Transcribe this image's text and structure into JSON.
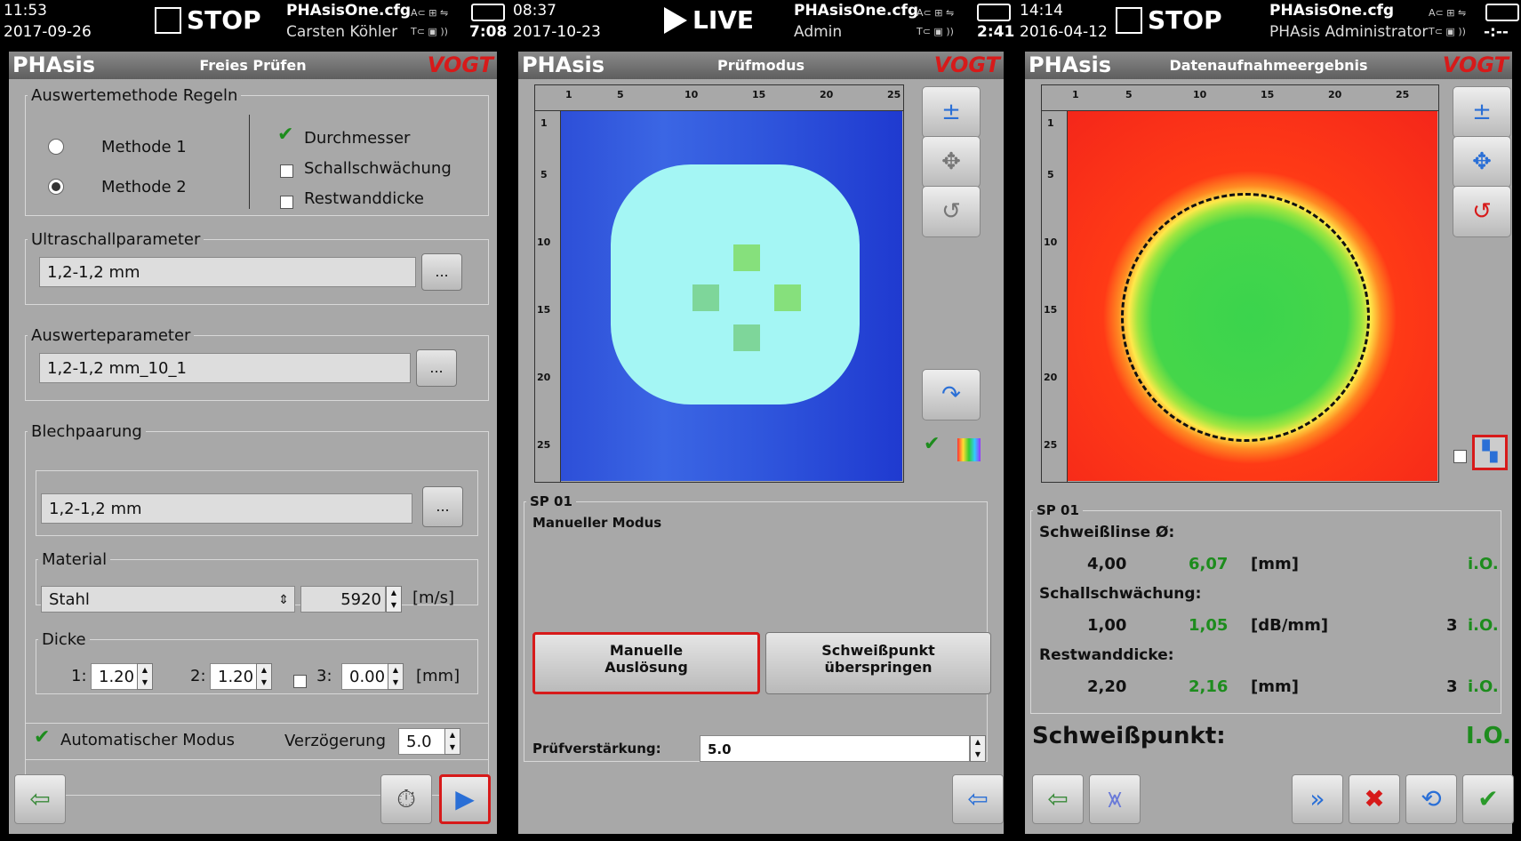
{
  "left": {
    "time": "11:53",
    "date": "2017-09-26",
    "mode": "STOP",
    "config": "PHAsisOne.cfg",
    "user": "Carsten Köhler",
    "clock": "7:08",
    "brand": "PHAsis",
    "title": "Freies Prüfen",
    "logo": "VOGT",
    "eval_method": {
      "legend": "Auswertemethode Regeln",
      "method1": "Methode 1",
      "method2": "Methode 2",
      "durchmesser": "Durchmesser",
      "schall": "Schallschwächung",
      "restwand": "Restwanddicke"
    },
    "ultrasound": {
      "legend": "Ultraschallparameter",
      "value": "1,2-1,2 mm",
      "more": "..."
    },
    "evalparam": {
      "legend": "Auswerteparameter",
      "value": "1,2-1,2 mm_10_1",
      "more": "..."
    },
    "sheet": {
      "legend": "Blechpaarung",
      "value": "1,2-1,2 mm",
      "more": "...",
      "material_legend": "Material",
      "material": "Stahl",
      "speed": "5920",
      "speed_unit": "[m/s]",
      "thickness_legend": "Dicke",
      "t1_label": "1:",
      "t1": "1.20",
      "t2_label": "2:",
      "t2": "1.20",
      "t3_label": "3:",
      "t3": "0.00",
      "t_unit": "[mm]"
    },
    "auto_mode": "Automatischer Modus",
    "delay_label": "Verzögerung",
    "delay": "5.0"
  },
  "middle": {
    "time": "08:37",
    "date": "2017-10-23",
    "mode": "LIVE",
    "config": "PHAsisOne.cfg",
    "user": "Admin",
    "clock": "2:41",
    "brand": "PHAsis",
    "title": "Prüfmodus",
    "logo": "VOGT",
    "sp": "SP 01",
    "mode_text": "Manueller Modus",
    "btn_manual_1": "Manuelle",
    "btn_manual_2": "Auslösung",
    "btn_skip_1": "Schweißpunkt",
    "btn_skip_2": "überspringen",
    "gain_label": "Prüfverstärkung:",
    "gain": "5.0"
  },
  "right": {
    "time": "14:14",
    "date": "2016-04-12",
    "mode": "STOP",
    "config": "PHAsisOne.cfg",
    "user": "PHAsis Administrator",
    "clock": "-:--",
    "brand": "PHAsis",
    "title": "Datenaufnahmeergebnis",
    "logo": "VOGT",
    "sp": "SP 01",
    "rows": [
      {
        "label": "Schweißlinse Ø:",
        "nominal": "4,00",
        "measured": "6,07",
        "unit": "[mm]",
        "count": "",
        "result": "i.O."
      },
      {
        "label": "Schallschwächung:",
        "nominal": "1,00",
        "measured": "1,05",
        "unit": "[dB/mm]",
        "count": "3",
        "result": "i.O."
      },
      {
        "label": "Restwanddicke:",
        "nominal": "2,20",
        "measured": "2,16",
        "unit": "[mm]",
        "count": "3",
        "result": "i.O."
      }
    ],
    "weld_label": "Schweißpunkt:",
    "weld_result": "I.O."
  },
  "ruler": {
    "x_ticks": [
      "1",
      "5",
      "10",
      "15",
      "20",
      "25"
    ],
    "y_ticks": [
      "1",
      "5",
      "10",
      "15",
      "20",
      "25"
    ]
  },
  "colors": {
    "accent_red": "#d71a1a",
    "ok_green": "#1d8c1d",
    "panel_gray": "#a8a8a8"
  }
}
